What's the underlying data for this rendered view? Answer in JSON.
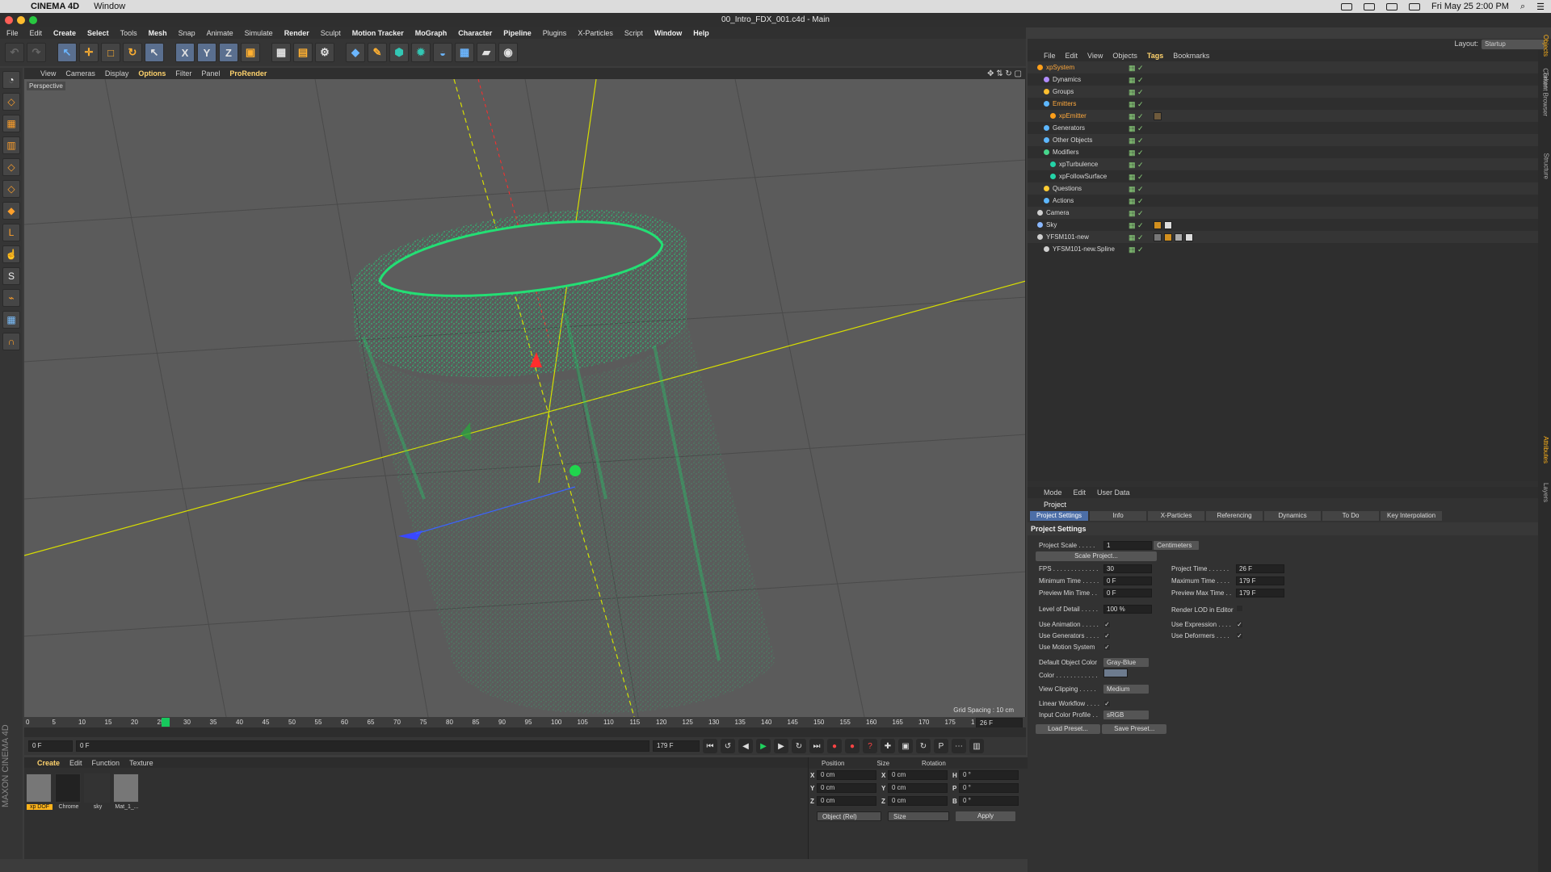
{
  "mac": {
    "apple": "",
    "app": "CINEMA 4D",
    "window": "Window",
    "datetime": "Fri May 25  2:00 PM"
  },
  "window": {
    "title": "00_Intro_FDX_001.c4d - Main"
  },
  "menu": [
    "File",
    "Edit",
    "Create",
    "Select",
    "Tools",
    "Mesh",
    "Snap",
    "Animate",
    "Simulate",
    "Render",
    "Sculpt",
    "Motion Tracker",
    "MoGraph",
    "Character",
    "Pipeline",
    "Plugins",
    "X-Particles",
    "Script",
    "Window",
    "Help"
  ],
  "viewport_menu": [
    "View",
    "Cameras",
    "Display",
    "Options",
    "Filter",
    "Panel",
    "ProRender"
  ],
  "viewport": {
    "label": "Perspective",
    "grid_spacing": "Grid Spacing : 10 cm"
  },
  "timeline": {
    "ticks": [
      "0",
      "5",
      "10",
      "15",
      "20",
      "25",
      "30",
      "35",
      "40",
      "45",
      "50",
      "55",
      "60",
      "65",
      "70",
      "75",
      "80",
      "85",
      "90",
      "95",
      "100",
      "105",
      "110",
      "115",
      "120",
      "125",
      "130",
      "135",
      "140",
      "145",
      "150",
      "155",
      "160",
      "165",
      "170",
      "175",
      "1"
    ],
    "current": "26",
    "end": "26 F",
    "current_frame": "0 F",
    "range_start": "0 F",
    "range_end": "179 F",
    "range_end2": "179 F"
  },
  "bottom_menu": [
    "Create",
    "Edit",
    "Function",
    "Texture"
  ],
  "materials": [
    "xp DOF",
    "Chrome",
    "sky",
    "Mat_1_..."
  ],
  "maxon": "MAXON CINEMA 4D",
  "coords": {
    "headers": [
      "Position",
      "Size",
      "Rotation"
    ],
    "rows": [
      {
        "a": "X",
        "v1": "0 cm",
        "b": "X",
        "v2": "0 cm",
        "c": "H",
        "v3": "0 °"
      },
      {
        "a": "Y",
        "v1": "0 cm",
        "b": "Y",
        "v2": "0 cm",
        "c": "P",
        "v3": "0 °"
      },
      {
        "a": "Z",
        "v1": "0 cm",
        "b": "Z",
        "v2": "0 cm",
        "c": "B",
        "v3": "0 °"
      }
    ],
    "object_mode": "Object (Rel)",
    "size_mode": "Size",
    "apply": "Apply"
  },
  "right": {
    "layout_label": "Layout:",
    "layout_value": "Startup",
    "object_menu": [
      "File",
      "Edit",
      "View",
      "Objects",
      "Tags",
      "Bookmarks"
    ],
    "objects": [
      {
        "name": "xpSystem",
        "hl": true,
        "indent": 0
      },
      {
        "name": "Dynamics",
        "indent": 1
      },
      {
        "name": "Groups",
        "indent": 1
      },
      {
        "name": "Emitters",
        "hl": true,
        "indent": 1
      },
      {
        "name": "xpEmitter",
        "hl": true,
        "indent": 2
      },
      {
        "name": "Generators",
        "indent": 1
      },
      {
        "name": "Other Objects",
        "indent": 1
      },
      {
        "name": "Modifiers",
        "indent": 1
      },
      {
        "name": "xpTurbulence",
        "indent": 2
      },
      {
        "name": "xpFollowSurface",
        "indent": 2
      },
      {
        "name": "Questions",
        "indent": 1
      },
      {
        "name": "Actions",
        "indent": 1
      },
      {
        "name": "Camera",
        "indent": 0
      },
      {
        "name": "Sky",
        "indent": 0
      },
      {
        "name": "YFSM101-new",
        "indent": 0
      },
      {
        "name": "YFSM101-new.Spline",
        "indent": 1
      }
    ],
    "attr_menu": [
      "Mode",
      "Edit",
      "User Data"
    ],
    "attr_title": "Project",
    "tabs": [
      "Project Settings",
      "Info",
      "X-Particles",
      "Referencing",
      "Dynamics",
      "To Do",
      "Key Interpolation"
    ],
    "section": "Project Settings",
    "fields": {
      "project_scale_label": "Project Scale . . . . .",
      "project_scale_value": "1",
      "unit": "Centimeters",
      "scale_project": "Scale Project...",
      "fps_label": "FPS . . . . . . . . . . . . .",
      "fps": "30",
      "project_time_label": "Project Time . . . . . .",
      "project_time": "26 F",
      "minimum_time_label": "Minimum Time . . . . .",
      "minimum_time": "0 F",
      "maximum_time_label": "Maximum Time . . . .",
      "maximum_time": "179 F",
      "preview_min_label": "Preview Min Time . .",
      "preview_min": "0 F",
      "preview_max_label": "Preview Max Time . .",
      "preview_max": "179 F",
      "lod_label": "Level of Detail . . . . .",
      "lod": "100 %",
      "render_lod_label": "Render LOD in Editor",
      "use_animation": "Use Animation . . . . .",
      "use_expression": "Use Expression . . . .",
      "use_generators": "Use Generators . . . .",
      "use_deformers": "Use Deformers . . . .",
      "use_motion": "Use Motion System",
      "default_color_label": "Default Object Color",
      "default_color": "Gray-Blue",
      "color_label": "Color . . . . . . . . . . . .",
      "view_clipping_label": "View Clipping . . . . .",
      "view_clipping": "Medium",
      "linear_workflow": "Linear Workflow . . . .",
      "input_profile_label": "Input Color Profile . .",
      "input_profile": "sRGB",
      "load_preset": "Load Preset...",
      "save_preset": "Save Preset..."
    },
    "side_tabs": [
      "Objects",
      "Takes",
      "Content Browser",
      "Structure",
      "Attributes",
      "Layers"
    ]
  },
  "colors": {
    "accent": "#ffb31a",
    "green": "#18d86b",
    "yellow": "#e5e000",
    "blue": "#4b74ff",
    "red": "#ff3030"
  }
}
